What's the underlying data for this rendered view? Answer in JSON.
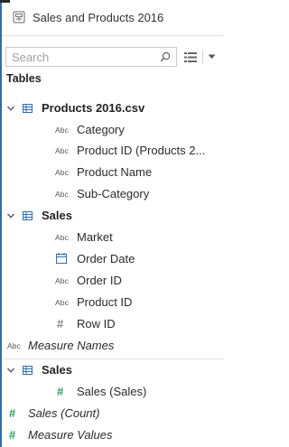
{
  "header": {
    "title": "Sales and Products 2016",
    "datasource_icon": "datasource-icon"
  },
  "search": {
    "placeholder": "Search",
    "search_icon": "magnifier-icon",
    "view_icon": "list-view-icon",
    "menu_icon": "dropdown-caret-icon"
  },
  "tables_heading": "Tables",
  "colors": {
    "accent": "#2f6fb0",
    "measure_green": "#2e9b5f"
  },
  "table1": {
    "name": "Products 2016.csv",
    "fields": [
      {
        "label": "Category",
        "type_badge": "Abc"
      },
      {
        "label": "Product ID (Products 2...",
        "type_badge": "Abc"
      },
      {
        "label": "Product Name",
        "type_badge": "Abc"
      },
      {
        "label": "Sub-Category",
        "type_badge": "Abc"
      }
    ]
  },
  "table2": {
    "name": "Sales",
    "fields": [
      {
        "label": "Market",
        "type_badge": "Abc"
      },
      {
        "label": "Order Date",
        "type_badge": "calendar-icon"
      },
      {
        "label": "Order ID",
        "type_badge": "Abc"
      },
      {
        "label": "Product ID",
        "type_badge": "Abc"
      },
      {
        "label": "Row ID",
        "type_badge": "#"
      }
    ]
  },
  "measure_names": {
    "label": "Measure Names",
    "type_badge": "Abc"
  },
  "table3": {
    "name": "Sales",
    "fields": [
      {
        "label": "Sales (Sales)",
        "type_badge": "#"
      }
    ]
  },
  "extra_measures": [
    {
      "label": "Sales (Count)",
      "type_badge": "#"
    },
    {
      "label": "Measure Values",
      "type_badge": "#"
    }
  ]
}
